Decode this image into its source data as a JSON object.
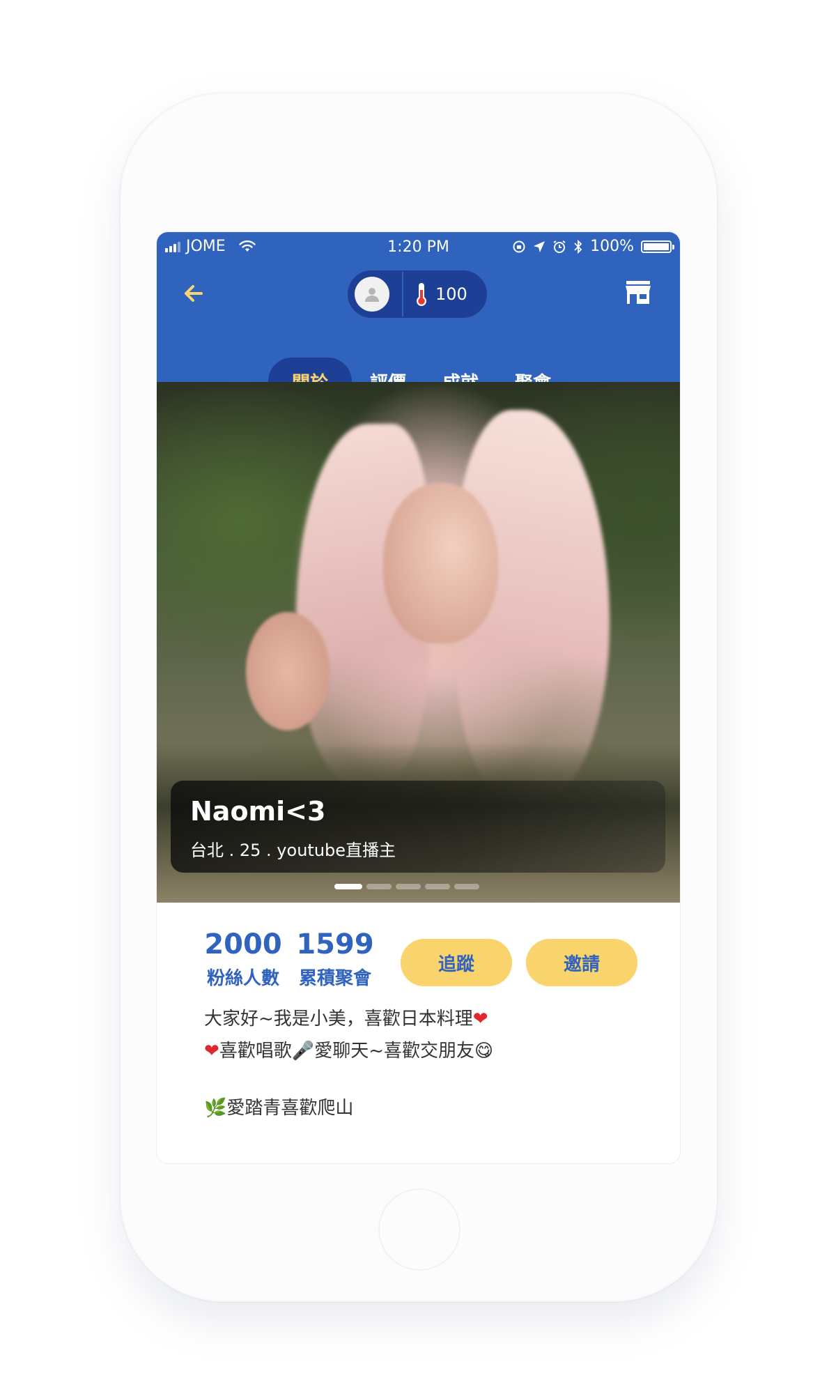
{
  "status_bar": {
    "carrier": "JOME",
    "time": "1:20 PM",
    "battery": "100%"
  },
  "header": {
    "temperature_value": "100"
  },
  "tabs": [
    "關於",
    "評價",
    "成就",
    "聚會"
  ],
  "profile": {
    "name": "Naomi<3",
    "meta": "台北 . 25 . youtube直播主"
  },
  "carousel": {
    "count": 5,
    "active_index": 0
  },
  "stats": {
    "fans_count": "2000",
    "fans_label": "粉絲人數",
    "meetups_count": "1599",
    "meetups_label": "累積聚會"
  },
  "actions": {
    "follow_label": "追蹤",
    "invite_label": "邀請"
  },
  "bio": {
    "line1": "大家好~我是小美，喜歡日本料理",
    "line2a": "喜歡唱歌",
    "line2b": "愛聊天~喜歡交朋友",
    "line3": "愛踏青喜歡爬山"
  },
  "colors": {
    "primary": "#2f63bd",
    "primary_dark": "#1e3f96",
    "accent": "#f9d46c"
  }
}
